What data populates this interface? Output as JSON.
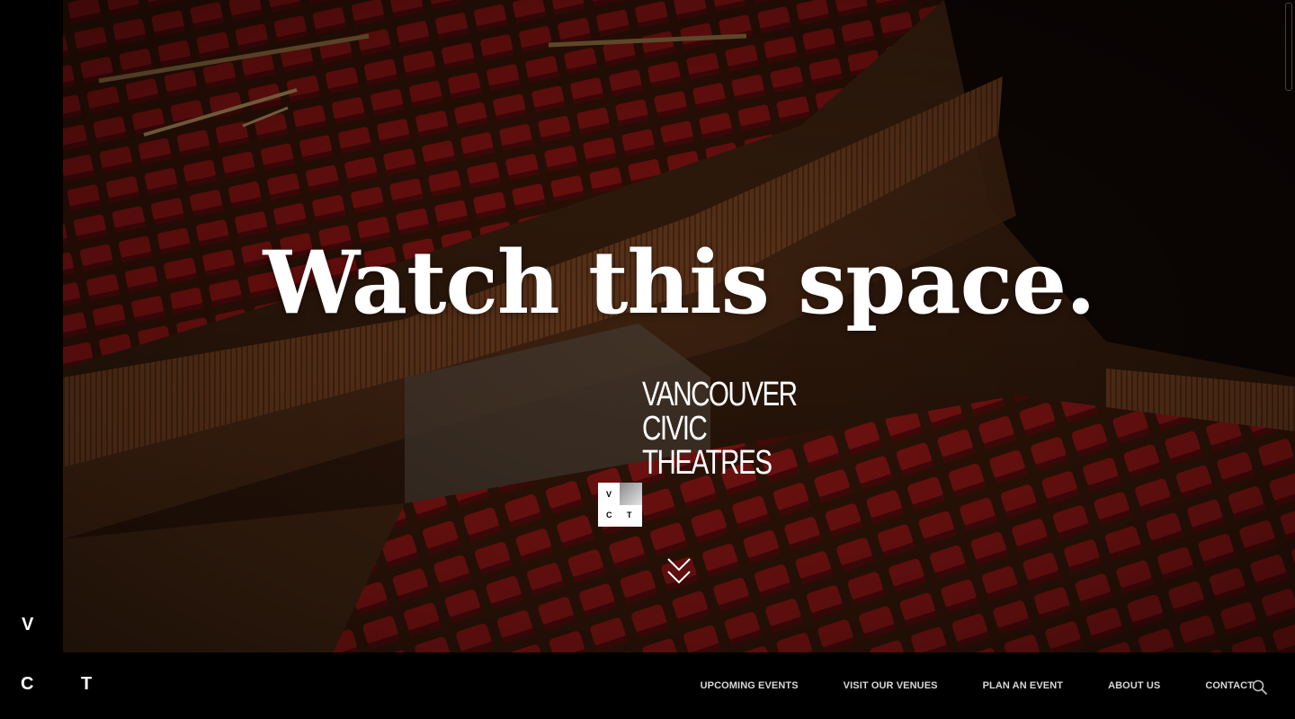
{
  "hero": {
    "headline": "Watch this space.",
    "wordmark": [
      "VANCOUVER",
      "CIVIC",
      "THEATRES"
    ],
    "logo_box_letters": [
      "V",
      "C",
      "T"
    ],
    "scroll_icon": "double-chevron-down-icon"
  },
  "side_logo": {
    "v": "V",
    "c": "C",
    "t": "T"
  },
  "nav": {
    "items": [
      {
        "label": "UPCOMING EVENTS"
      },
      {
        "label": "VISIT OUR VENUES"
      },
      {
        "label": "PLAN AN EVENT"
      },
      {
        "label": "ABOUT US"
      },
      {
        "label": "CONTACT"
      }
    ],
    "search_icon": "search-icon"
  },
  "colors": {
    "background": "#000000",
    "text": "#ffffff",
    "nav_text": "#d8d8d8",
    "seat_red": "#8e1414"
  }
}
